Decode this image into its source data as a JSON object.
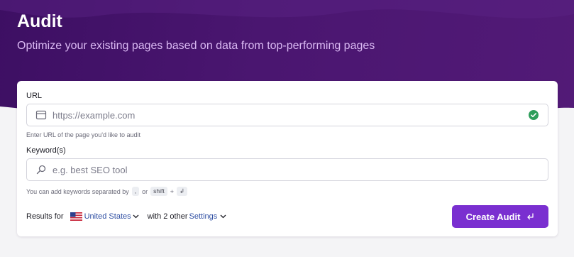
{
  "header": {
    "title": "Audit",
    "subtitle": "Optimize your existing pages based on data from top-performing pages"
  },
  "form": {
    "url": {
      "label": "URL",
      "placeholder": "https://example.com",
      "icon": "browser-window-icon",
      "status_icon": "valid-check-icon",
      "hint": "Enter URL of the page you'd like to audit"
    },
    "keywords": {
      "label": "Keyword(s)",
      "placeholder": "e.g. best SEO tool",
      "icon": "search-icon",
      "hint_prefix": "You can add keywords separated by",
      "hint_key_comma": ",",
      "hint_or": "or",
      "hint_key_shift": "shift",
      "hint_plus": "+",
      "hint_key_enter": "↲"
    },
    "results": {
      "prefix": "Results for",
      "country": "United States",
      "with_text": "with 2 other",
      "settings_label": "Settings"
    },
    "submit": {
      "label": "Create Audit",
      "icon": "enter-arrow-icon"
    }
  },
  "colors": {
    "header_bg": "#4a1670",
    "accent": "#7a2fd0",
    "success": "#2e9e5b",
    "link": "#2f4fa3"
  }
}
